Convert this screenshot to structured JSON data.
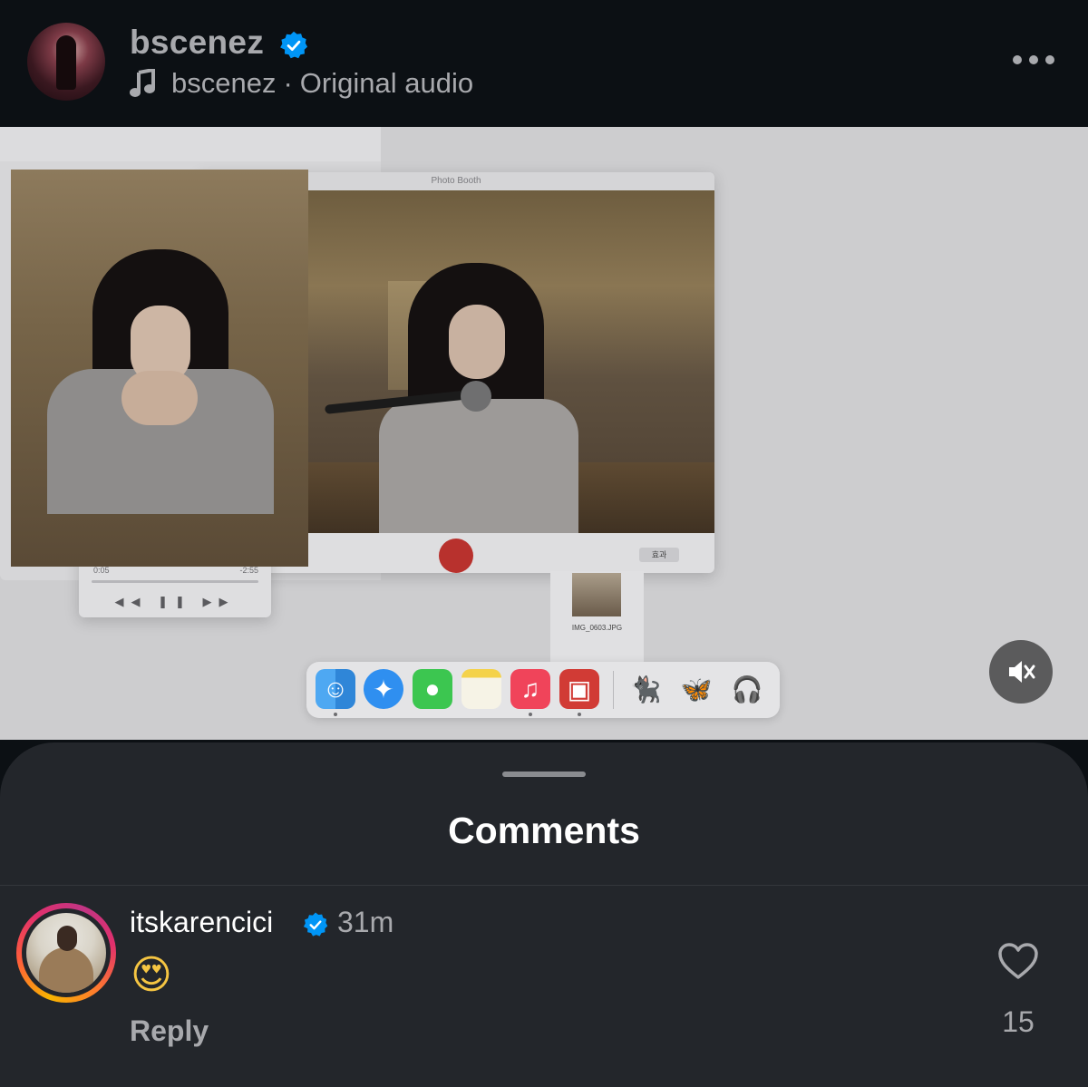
{
  "post": {
    "username": "bscenez",
    "audio_owner": "bscenez",
    "audio_separator": "·",
    "audio_label": "Original audio"
  },
  "video": {
    "photobooth_title": "Photo Booth",
    "photobooth_effects_label": "효과",
    "music_elapsed": "0:05",
    "music_remaining": "-2:55",
    "thumbnail_filename": "IMG_0603.JPG",
    "dock_emojis": [
      "🐈‍⬛",
      "🦋",
      "🎧"
    ],
    "muted": true
  },
  "comments_sheet": {
    "title": "Comments",
    "comments": [
      {
        "username": "itskarencici",
        "time": "31m",
        "text": "😍",
        "reply_label": "Reply",
        "like_count": "15"
      }
    ]
  },
  "colors": {
    "verified_blue": "#0095f6",
    "sheet_bg": "#23262b",
    "header_bg": "#0c1014",
    "muted_text": "#a8a9ad"
  }
}
